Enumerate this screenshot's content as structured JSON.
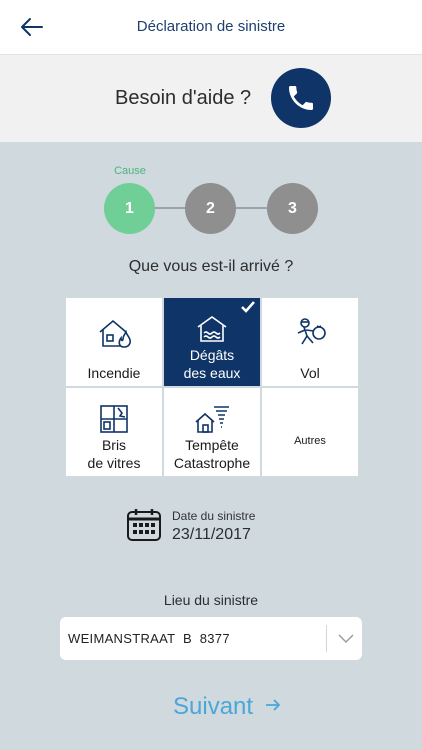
{
  "header": {
    "title": "Déclaration de sinistre"
  },
  "help": {
    "text": "Besoin d'aide ?"
  },
  "stepper": {
    "caption": "Cause",
    "steps": [
      "1",
      "2",
      "3"
    ],
    "current": 1
  },
  "question": "Que vous est-il arrivé ?",
  "causes": [
    {
      "label_lines": [
        "Incendie"
      ],
      "icon": "house-fire-icon",
      "selected": false
    },
    {
      "label_lines": [
        "Dégâts",
        "des eaux"
      ],
      "icon": "water-damage-icon",
      "selected": true
    },
    {
      "label_lines": [
        "Vol"
      ],
      "icon": "thief-icon",
      "selected": false
    },
    {
      "label_lines": [
        "Bris",
        "de vitres"
      ],
      "icon": "broken-glass-icon",
      "selected": false
    },
    {
      "label_lines": [
        "Tempête",
        "Catastrophe"
      ],
      "icon": "storm-icon",
      "selected": false
    },
    {
      "label_lines": [
        "Autres"
      ],
      "icon": null,
      "selected": false
    }
  ],
  "date": {
    "label": "Date du sinistre",
    "value": "23/11/2017"
  },
  "lieu": {
    "label": "Lieu du sinistre",
    "value": "WEIMANSTRAAT  B  8377"
  },
  "next": {
    "label": "Suivant"
  },
  "colors": {
    "navy": "#0e3468",
    "step_active": "#6fcf97",
    "step_inactive": "#8f8f8f",
    "accent": "#4aa7d8",
    "background": "#cfd9de"
  }
}
